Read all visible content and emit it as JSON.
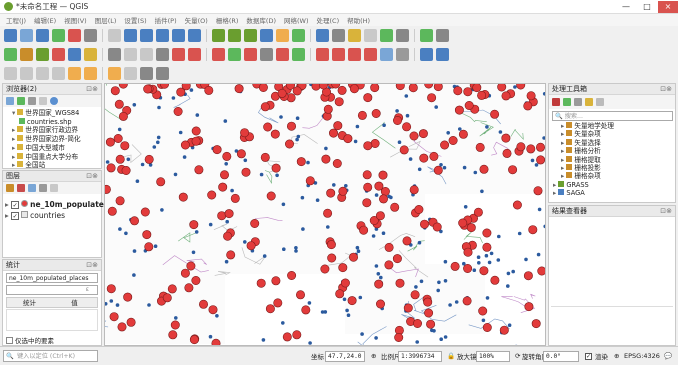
{
  "window": {
    "title": "*未命名工程 — QGIS",
    "min": "—",
    "max": "□",
    "close": "×"
  },
  "menus": [
    "工程(J)",
    "编辑(E)",
    "视图(V)",
    "图层(L)",
    "设置(S)",
    "插件(P)",
    "矢量(O)",
    "栅格(R)",
    "数据库(D)",
    "网络(W)",
    "处理(C)",
    "帮助(H)"
  ],
  "browser": {
    "title": "浏览器(2)",
    "items": [
      {
        "label": "世界国家_WGS84",
        "indent": 1,
        "arrow": "▾"
      },
      {
        "label": "countries.shp",
        "indent": 2,
        "arrow": ""
      },
      {
        "label": "世界国家行政边界",
        "indent": 1,
        "arrow": "▸"
      },
      {
        "label": "世界国家边界-简化",
        "indent": 1,
        "arrow": "▸"
      },
      {
        "label": "中国大型城市",
        "indent": 1,
        "arrow": "▸"
      },
      {
        "label": "中国重点大学分布",
        "indent": 1,
        "arrow": "▸"
      },
      {
        "label": "全国站",
        "indent": 1,
        "arrow": "▸"
      },
      {
        "label": "全国机场数据",
        "indent": 1,
        "arrow": "▸"
      },
      {
        "label": "全国旅飞区数据集",
        "indent": 1,
        "arrow": "▸"
      }
    ]
  },
  "layers": {
    "title": "图层",
    "items": [
      {
        "label": "ne_10m_populated",
        "checked": true
      },
      {
        "label": "countries",
        "checked": true
      }
    ]
  },
  "stats": {
    "title": "统计",
    "layer": "ne_10m_populated_places",
    "col1": "统计",
    "col2": "值",
    "filter_label": "仅选中的要素"
  },
  "toolbox": {
    "title": "处理工具箱",
    "search_placeholder": "搜索...",
    "items": [
      {
        "label": "矢量地学处理",
        "indent": 1
      },
      {
        "label": "矢量杂项",
        "indent": 1
      },
      {
        "label": "矢量选择",
        "indent": 1
      },
      {
        "label": "栅格分析",
        "indent": 1
      },
      {
        "label": "栅格提取",
        "indent": 1
      },
      {
        "label": "栅格投影",
        "indent": 1
      },
      {
        "label": "栅格杂项",
        "indent": 1
      },
      {
        "label": "GRASS",
        "indent": 0
      },
      {
        "label": "SAGA",
        "indent": 0
      }
    ]
  },
  "result_viewer": {
    "title": "结果查看器"
  },
  "status": {
    "locator_placeholder": "键入以定位 (Ctrl+K)",
    "coord_label": "坐标",
    "coord_value": "47.7,24.0",
    "scale_label": "比例尺",
    "scale_value": "1:3996734",
    "magnifier_label": "放大镜",
    "magnifier_value": "100%",
    "rotation_label": "旋转角度",
    "rotation_value": "0.0°",
    "render_label": "渲染",
    "crs": "EPSG:4326"
  },
  "map": {
    "city_color": "#e23b3b",
    "dot_color": "#2b5a9e",
    "land_color": "#ffffff"
  }
}
